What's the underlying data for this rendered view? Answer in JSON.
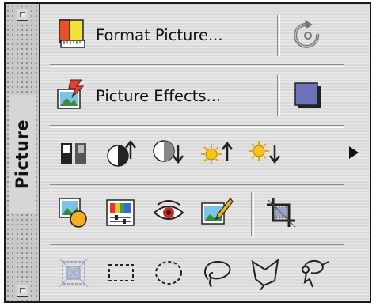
{
  "palette": {
    "title": "Picture",
    "buttons": {
      "format_picture": "Format Picture...",
      "picture_effects": "Picture Effects..."
    },
    "icons": [
      "format-picture-icon",
      "rotate-icon",
      "picture-effects-icon",
      "shadow-icon",
      "color-mode-icon",
      "more-contrast-icon",
      "less-contrast-icon",
      "more-brightness-icon",
      "less-brightness-icon",
      "more-arrow-icon",
      "insert-picture-icon",
      "color-balance-icon",
      "red-eye-icon",
      "edit-picture-icon",
      "crop-icon",
      "select-all-icon",
      "rectangle-marquee-icon",
      "oval-marquee-icon",
      "lasso-icon",
      "polygon-lasso-icon",
      "freeform-select-icon"
    ]
  }
}
